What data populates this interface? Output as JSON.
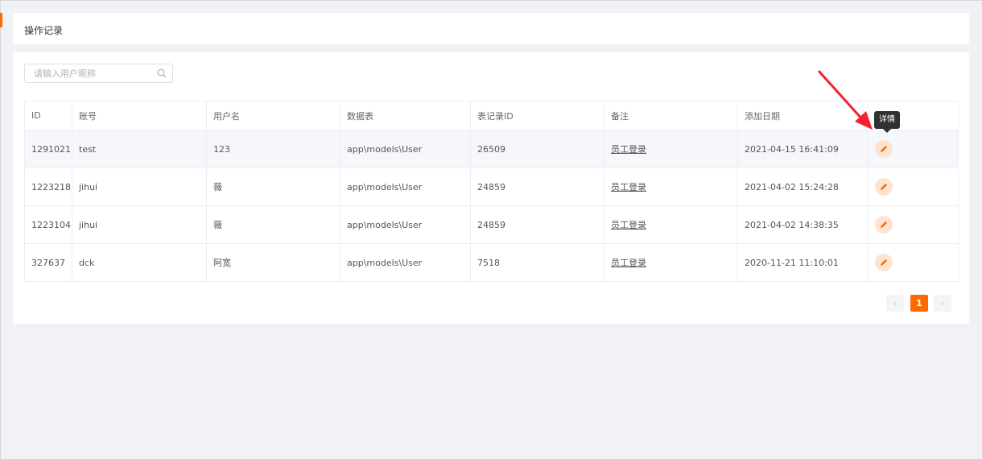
{
  "header": {
    "title": "操作记录"
  },
  "search": {
    "placeholder": "请输入用户昵称",
    "value": "",
    "icon": "search-icon"
  },
  "table": {
    "columns": [
      "ID",
      "账号",
      "用户名",
      "数据表",
      "表记录ID",
      "备注",
      "添加日期",
      ""
    ],
    "rows": [
      {
        "id": "1291021",
        "account": "test",
        "username": "123",
        "table": "app\\models\\User",
        "record_id": "26509",
        "remark": "员工登录",
        "date": "2021-04-15 16:41:09"
      },
      {
        "id": "1223218",
        "account": "jihui",
        "username": "薇",
        "table": "app\\models\\User",
        "record_id": "24859",
        "remark": "员工登录",
        "date": "2021-04-02 15:24:28"
      },
      {
        "id": "1223104",
        "account": "jihui",
        "username": "薇",
        "table": "app\\models\\User",
        "record_id": "24859",
        "remark": "员工登录",
        "date": "2021-04-02 14:38:35"
      },
      {
        "id": "327637",
        "account": "dck",
        "username": "阿宽",
        "table": "app\\models\\User",
        "record_id": "7518",
        "remark": "员工登录",
        "date": "2020-11-21 11:10:01"
      }
    ],
    "action_icon": "pencil-icon"
  },
  "tooltip": {
    "text": "详情"
  },
  "pagination": {
    "prev": "‹",
    "current": "1",
    "next": "›"
  },
  "colors": {
    "accent": "#ff6a00",
    "action_bg": "#ffe3d1",
    "arrow": "#f5222d",
    "tooltip_bg": "#303133"
  }
}
